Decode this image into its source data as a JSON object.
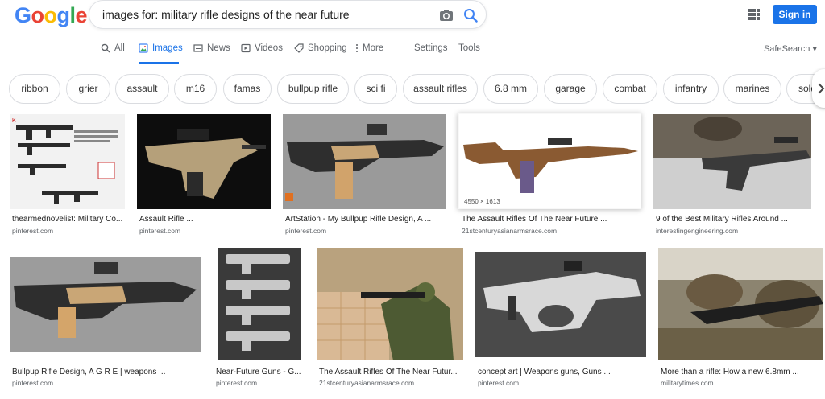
{
  "logo": {
    "letters": [
      "G",
      "o",
      "o",
      "g",
      "l",
      "e"
    ],
    "colors": [
      "#4285F4",
      "#EA4335",
      "#FBBC05",
      "#4285F4",
      "#34A853",
      "#EA4335"
    ]
  },
  "search": {
    "query": "images for: military rifle designs of the near future"
  },
  "header": {
    "signin_label": "Sign in"
  },
  "tabs": [
    {
      "label": "All",
      "icon": "search-icon"
    },
    {
      "label": "Images",
      "icon": "image-icon"
    },
    {
      "label": "News",
      "icon": "news-icon"
    },
    {
      "label": "Videos",
      "icon": "play-icon"
    },
    {
      "label": "Shopping",
      "icon": "tag-icon"
    },
    {
      "label": "More",
      "icon": "more-vert-icon"
    },
    {
      "label": "Settings"
    },
    {
      "label": "Tools"
    }
  ],
  "safesearch": "SafeSearch ▾",
  "chips": [
    "ribbon",
    "grier",
    "assault",
    "m16",
    "famas",
    "bullpup rifle",
    "sci fi",
    "assault rifles",
    "6.8 mm",
    "garage",
    "combat",
    "infantry",
    "marines",
    "soldier"
  ],
  "results": [
    {
      "title": "thearmednovelist: Military Co...",
      "source": "pinterest.com"
    },
    {
      "title": "Assault Rifle ...",
      "source": "pinterest.com"
    },
    {
      "title": "ArtStation - My Bullpup Rifle Design, A ...",
      "source": "pinterest.com"
    },
    {
      "title": "The Assault Rifles Of The Near Future ...",
      "source": "21stcenturyasianarmsrace.com",
      "dimensions": "4550 × 1613"
    },
    {
      "title": "9 of the Best Military Rifles Around ...",
      "source": "interestingengineering.com"
    },
    {
      "title": "Bullpup Rifle Design, A G R E | weapons ...",
      "source": "pinterest.com"
    },
    {
      "title": "Near-Future Guns - G...",
      "source": "pinterest.com"
    },
    {
      "title": "The Assault Rifles Of The Near Futur...",
      "source": "21stcenturyasianarmsrace.com"
    },
    {
      "title": "concept art | Weapons guns, Guns ...",
      "source": "pinterest.com"
    },
    {
      "title": "More than a rifle: How a new 6.8mm ...",
      "source": "militarytimes.com"
    }
  ],
  "colors": {
    "accent": "#1a73e8",
    "tab_text": "#5f6368"
  }
}
